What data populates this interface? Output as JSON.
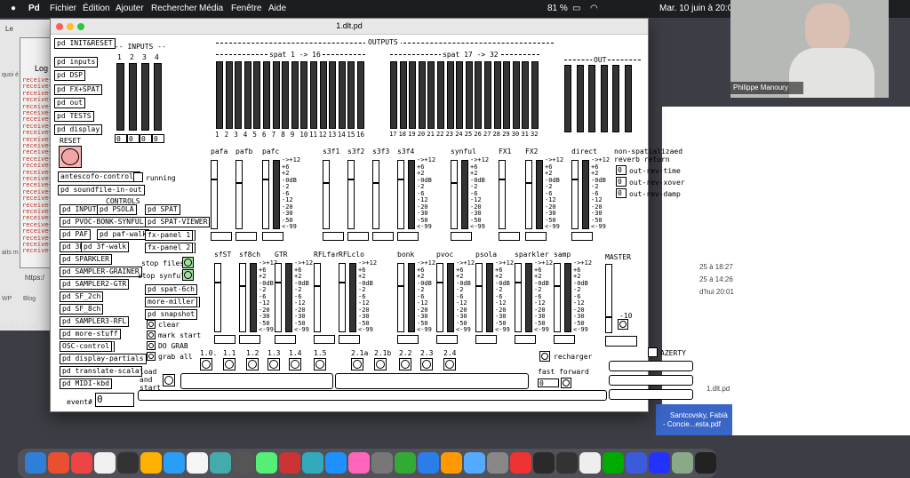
{
  "menubar": {
    "app": "Pd",
    "items": [
      "Fichier",
      "Édition",
      "Ajouter",
      "Rechercher",
      "Média",
      "Fenêtre",
      "Aide"
    ],
    "battery": "81 %",
    "datetime": "Mar. 10 juin à 20:01"
  },
  "background": {
    "log_title": "Log",
    "log_tab": "Le",
    "receive_lines": [
      "receive~",
      "receive~",
      "receive~",
      "receive~",
      "receive~",
      "receive~",
      "receive~",
      "receive~",
      "receive~",
      "receive~",
      "receive~",
      "receive~",
      "receive~",
      "receive~",
      "receive~",
      "receive~",
      "receive~",
      "receive~",
      "receive~",
      "receive~",
      "receive~",
      "receive~",
      "receive~",
      "receive~",
      "receive~",
      "receive~",
      "receive~"
    ],
    "frag_quoi": "quoi é",
    "frag_its": "aits m",
    "frag_https": "https:/",
    "frag_wp": "WP",
    "frag_blog": "Blog",
    "frag_mp3": "xtrati).mp3",
    "dates": [
      "25 à 18:27",
      "25 à 14:26",
      "d'hui 20:01"
    ],
    "file1": "1.dlt.pd",
    "file2_l1": "Santcovsky, Fabià",
    "file2_l2": "- Concie...esta.pdf",
    "video_name": "Philippe Manoury"
  },
  "window": {
    "title": "1.dlt.pd"
  },
  "left": {
    "init_reset": "pd INIT&RESET",
    "inputs": "pd inputs",
    "dsp": "pd DSP",
    "fxspat": "pd FX+SPAT",
    "out": "pd out",
    "tests": "pd TESTS",
    "display": "pd display",
    "reset": "RESET",
    "antescofo": "antescofo-controls",
    "running": "running",
    "soundfile": "pd soundfile-in-out",
    "controls": "CONTROLS",
    "buttons": [
      "pd INPUTS",
      "pd PSOLA",
      "pd PVOC-BONK-SYNFUL",
      "pd PAF",
      "pd paf-walk",
      "pd 3F",
      "pd 3f-walk",
      "pd SPARKLER",
      "pd SAMPLER-GRAINER",
      "pd SAMPLER2-GTR",
      "pd SF_2ch",
      "pd SF_8ch",
      "pd SAMPLER3-RFL",
      "pd more-stuff",
      "OSC-control",
      "pd display-partials",
      "pd translate-scala",
      "pd MIDI-kbd"
    ],
    "event": "event#",
    "event_val": "0"
  },
  "mid": {
    "spat": "pd SPAT",
    "spat_viewer": "pd SPAT-VIEWER",
    "fxp1": "fx-panel 1",
    "fxp2": "fx-panel 2",
    "stop_files": "stop files",
    "stop_synful": "stop synful",
    "spat6": "pd spat-6ch",
    "more_miller": "more-miller",
    "snapshot": "pd snapshot",
    "clear": "clear",
    "mark_start": "mark start",
    "do_grab": "DO GRAB",
    "grab_all": "grab all",
    "load_start_1": "load",
    "load_start_2": "and",
    "load_start_3": "start"
  },
  "inputs": {
    "label": "-- INPUTS --",
    "nums": [
      "1",
      "2",
      "3",
      "4"
    ],
    "vals": [
      "0",
      "0",
      "0",
      "0"
    ]
  },
  "outputs": {
    "label": "OUTPUTS",
    "spat1": "spat 1 -> 16",
    "spat2": "spat 17 -> 32",
    "out": "OUT",
    "nums1": [
      "1",
      "2",
      "3",
      "4",
      "5",
      "6",
      "7",
      "8",
      "9",
      "10",
      "11",
      "12",
      "13",
      "14",
      "15",
      "16"
    ],
    "nums2": [
      "17",
      "18",
      "19",
      "20",
      "21",
      "22",
      "23",
      "24",
      "25",
      "26",
      "27",
      "28",
      "29",
      "30",
      "31",
      "32"
    ]
  },
  "scale": "->+12\n+6\n+2\n-0dB\n-2\n-6\n-12\n-20\n-30\n-50\n<-99",
  "row1": {
    "labels": [
      "pafa",
      "pafb",
      "pafc",
      "s3f1",
      "s3f2",
      "s3f3",
      "s3f4",
      "synful",
      "FX1",
      "FX2",
      "direct"
    ],
    "nonspat1": "non-spatializaed",
    "nonspat2": "reverb return",
    "rev": [
      {
        "v": "0",
        "l": "out-rev-time"
      },
      {
        "v": "0",
        "l": "out-rev-xover"
      },
      {
        "v": "0",
        "l": "out-rev-damp"
      }
    ]
  },
  "row2": {
    "labels": [
      "sfST",
      "sf8ch",
      "GTR",
      "RFLfar",
      "RFLclo",
      "bonk",
      "pvoc",
      "psola",
      "sparkler",
      "samp"
    ],
    "master": "MASTER",
    "master_val": "-10",
    "azerty": "AZERTY"
  },
  "cues": {
    "labels": [
      "1.0.",
      "1.1",
      "1.2",
      "1.3",
      "1.4",
      "1.5",
      "2.1a",
      "2.1b",
      "2.2",
      "2.3",
      "2.4"
    ],
    "recharger": "recharger",
    "fast_forward": "fast forward",
    "ff_val": "0"
  }
}
